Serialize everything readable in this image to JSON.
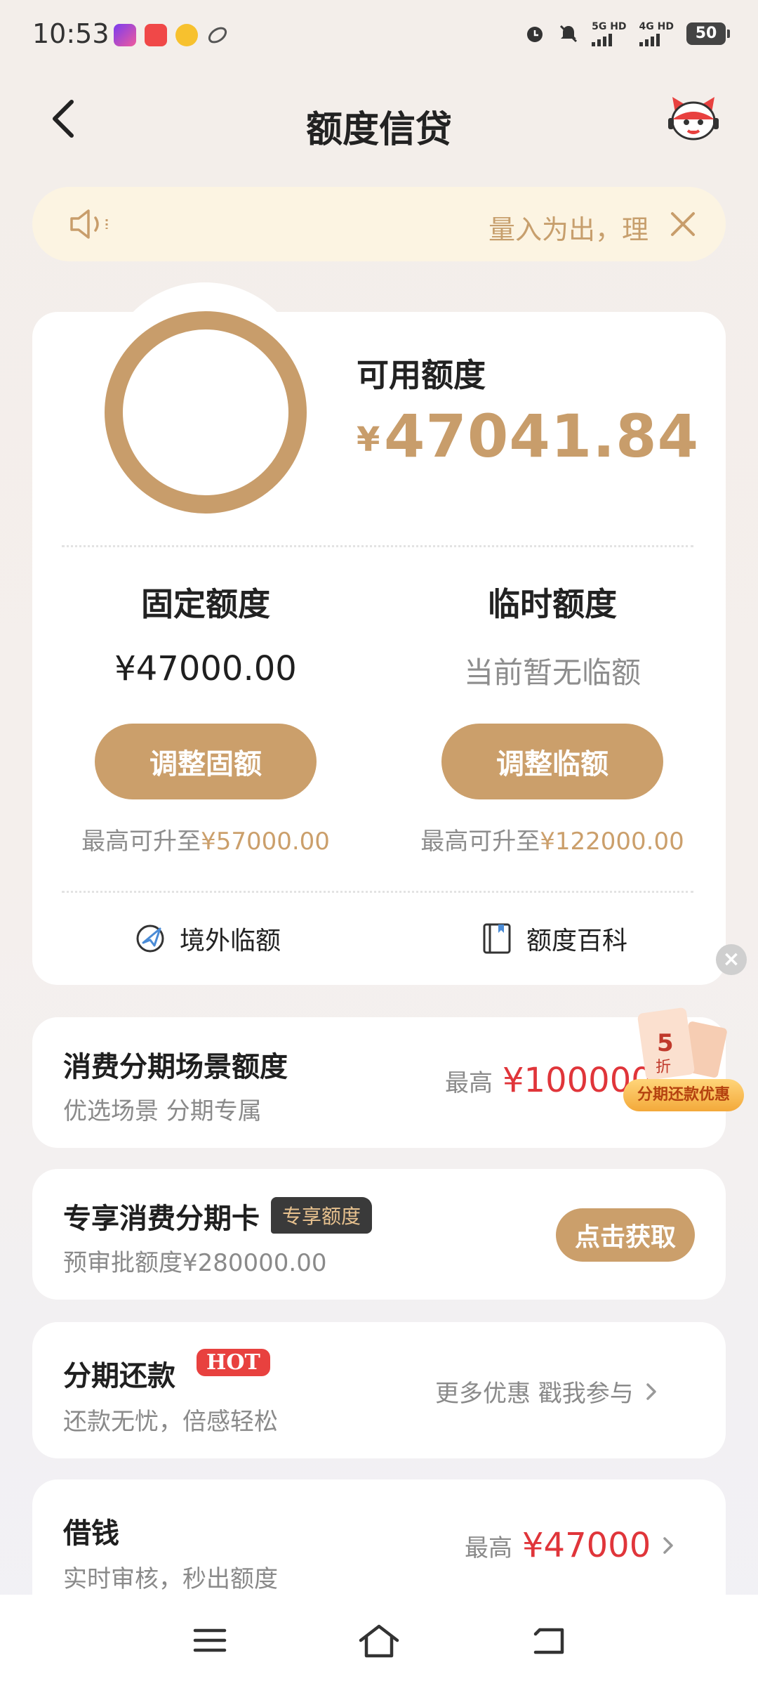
{
  "status_bar": {
    "time": "10:53",
    "network_1": "5G HD",
    "network_2": "4G HD",
    "battery": "50"
  },
  "header": {
    "title": "额度信贷"
  },
  "notice": {
    "text": "量入为出，理"
  },
  "credit": {
    "available_label": "可用额度",
    "available_currency": "¥",
    "available_amount": "47041.84",
    "fixed": {
      "title": "固定额度",
      "value": "¥47000.00",
      "button": "调整固额",
      "note_prefix": "最高可升至",
      "note_amount": "¥57000.00"
    },
    "temporary": {
      "title": "临时额度",
      "value": "当前暂无临额",
      "button": "调整临额",
      "note_prefix": "最高可升至",
      "note_amount": "¥122000.00"
    },
    "links": {
      "overseas": "境外临额",
      "encyclopedia": "额度百科"
    }
  },
  "installment_scene": {
    "title": "消费分期场景额度",
    "subtitle": "优选场景 分期专属",
    "max_label": "最高",
    "max_amount": "¥100000"
  },
  "promo_badge": {
    "label": "分期还款优惠",
    "discount_number": "5",
    "discount_unit": "折"
  },
  "exclusive_card": {
    "title": "专享消费分期卡",
    "tag": "专享额度",
    "subtitle": "预审批额度¥280000.00",
    "button": "点击获取"
  },
  "installment_repay": {
    "title": "分期还款",
    "tag": "HOT",
    "subtitle": "还款无忧，倍感轻松",
    "right_text": "更多优惠 戳我参与"
  },
  "borrow": {
    "title": "借钱",
    "subtitle": "实时审核，秒出额度",
    "max_label": "最高",
    "max_amount": "¥47000"
  },
  "colors": {
    "accent": "#c89d6b",
    "price_red": "#e0353a",
    "notice_bg": "#fcf4e2"
  }
}
